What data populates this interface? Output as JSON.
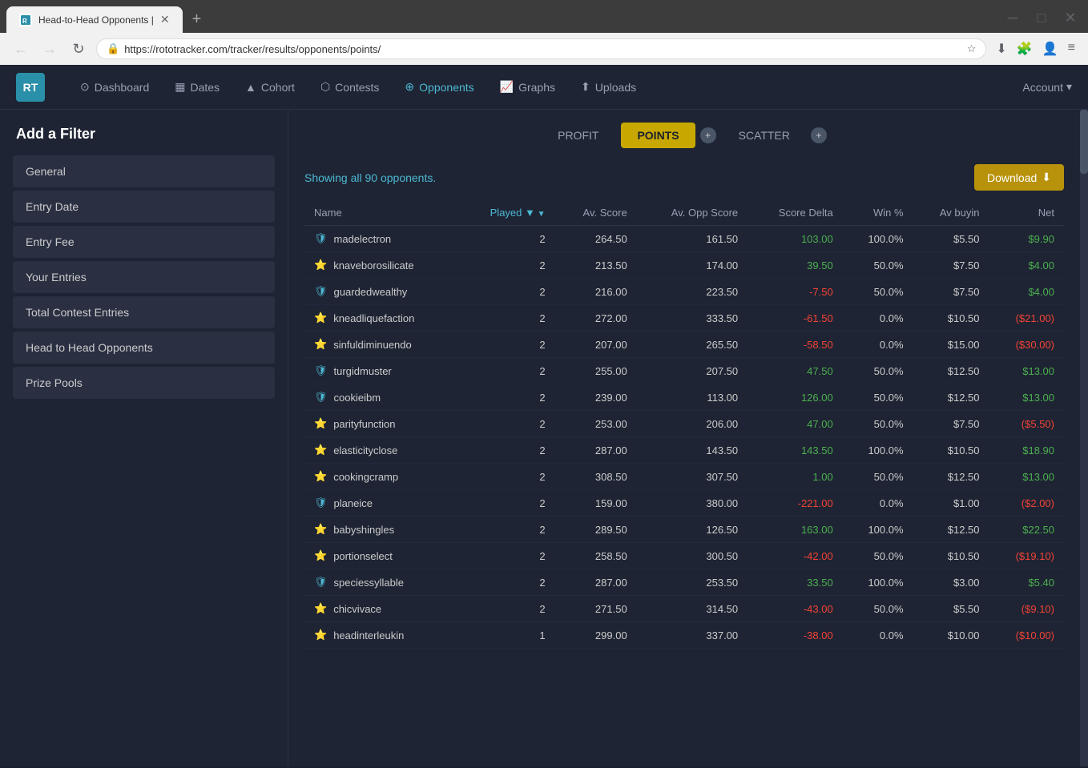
{
  "browser": {
    "tab_title": "Head-to-Head Opponents |",
    "url": "https://rototracker.com/tracker/results/opponents/points/",
    "new_tab_label": "+"
  },
  "nav": {
    "logo_text": "RT",
    "items": [
      {
        "label": "Dashboard",
        "icon": "⊙",
        "active": false
      },
      {
        "label": "Dates",
        "icon": "▦",
        "active": false
      },
      {
        "label": "Cohort",
        "icon": "▲",
        "active": false
      },
      {
        "label": "Contests",
        "icon": "⬡",
        "active": false
      },
      {
        "label": "Opponents",
        "icon": "⊕",
        "active": true
      },
      {
        "label": "Graphs",
        "icon": "📈",
        "active": false
      },
      {
        "label": "Uploads",
        "icon": "⬆",
        "active": false
      }
    ],
    "account_label": "Account"
  },
  "sidebar": {
    "title": "Add a Filter",
    "items": [
      {
        "label": "General"
      },
      {
        "label": "Entry Date"
      },
      {
        "label": "Entry Fee"
      },
      {
        "label": "Your Entries"
      },
      {
        "label": "Total Contest Entries"
      },
      {
        "label": "Head to Head Opponents"
      },
      {
        "label": "Prize Pools"
      }
    ]
  },
  "subtabs": [
    {
      "label": "PROFIT",
      "active": false
    },
    {
      "label": "POINTS",
      "active": true,
      "has_add": true
    },
    {
      "label": "SCATTER",
      "active": false,
      "has_add": true
    }
  ],
  "table": {
    "showing_text": "Showing all ",
    "showing_count": "90",
    "showing_suffix": " opponents.",
    "download_label": "Download",
    "columns": [
      "Name",
      "Played",
      "Av. Score",
      "Av. Opp Score",
      "Score Delta",
      "Win %",
      "Av buyin",
      "Net"
    ],
    "sorted_col": "Played",
    "rows": [
      {
        "name": "madelectron",
        "icon": "shield",
        "played": 2,
        "av_score": "264.50",
        "av_opp": "161.50",
        "delta": "103.00",
        "delta_type": "positive",
        "win": "100.0%",
        "buyin": "$5.50",
        "net": "$9.90",
        "net_type": "positive"
      },
      {
        "name": "knaveborosilicate",
        "icon": "star",
        "played": 2,
        "av_score": "213.50",
        "av_opp": "174.00",
        "delta": "39.50",
        "delta_type": "positive",
        "win": "50.0%",
        "buyin": "$7.50",
        "net": "$4.00",
        "net_type": "positive"
      },
      {
        "name": "guardedwealthy",
        "icon": "shield",
        "played": 2,
        "av_score": "216.00",
        "av_opp": "223.50",
        "delta": "-7.50",
        "delta_type": "negative",
        "win": "50.0%",
        "buyin": "$7.50",
        "net": "$4.00",
        "net_type": "positive"
      },
      {
        "name": "kneadliquefaction",
        "icon": "star",
        "played": 2,
        "av_score": "272.00",
        "av_opp": "333.50",
        "delta": "-61.50",
        "delta_type": "negative",
        "win": "0.0%",
        "buyin": "$10.50",
        "net": "($21.00)",
        "net_type": "negative"
      },
      {
        "name": "sinfuldiminuendo",
        "icon": "star",
        "played": 2,
        "av_score": "207.00",
        "av_opp": "265.50",
        "delta": "-58.50",
        "delta_type": "negative",
        "win": "0.0%",
        "buyin": "$15.00",
        "net": "($30.00)",
        "net_type": "negative"
      },
      {
        "name": "turgidmuster",
        "icon": "shield",
        "played": 2,
        "av_score": "255.00",
        "av_opp": "207.50",
        "delta": "47.50",
        "delta_type": "positive",
        "win": "50.0%",
        "buyin": "$12.50",
        "net": "$13.00",
        "net_type": "positive"
      },
      {
        "name": "cookieibm",
        "icon": "shield",
        "played": 2,
        "av_score": "239.00",
        "av_opp": "113.00",
        "delta": "126.00",
        "delta_type": "positive",
        "win": "50.0%",
        "buyin": "$12.50",
        "net": "$13.00",
        "net_type": "positive"
      },
      {
        "name": "parityfunction",
        "icon": "star",
        "played": 2,
        "av_score": "253.00",
        "av_opp": "206.00",
        "delta": "47.00",
        "delta_type": "positive",
        "win": "50.0%",
        "buyin": "$7.50",
        "net": "($5.50)",
        "net_type": "negative"
      },
      {
        "name": "elasticityclose",
        "icon": "star",
        "played": 2,
        "av_score": "287.00",
        "av_opp": "143.50",
        "delta": "143.50",
        "delta_type": "positive",
        "win": "100.0%",
        "buyin": "$10.50",
        "net": "$18.90",
        "net_type": "positive"
      },
      {
        "name": "cookingcramp",
        "icon": "star",
        "played": 2,
        "av_score": "308.50",
        "av_opp": "307.50",
        "delta": "1.00",
        "delta_type": "positive",
        "win": "50.0%",
        "buyin": "$12.50",
        "net": "$13.00",
        "net_type": "positive"
      },
      {
        "name": "planeice",
        "icon": "shield",
        "played": 2,
        "av_score": "159.00",
        "av_opp": "380.00",
        "delta": "-221.00",
        "delta_type": "negative",
        "win": "0.0%",
        "buyin": "$1.00",
        "net": "($2.00)",
        "net_type": "negative"
      },
      {
        "name": "babyshingles",
        "icon": "star",
        "played": 2,
        "av_score": "289.50",
        "av_opp": "126.50",
        "delta": "163.00",
        "delta_type": "positive",
        "win": "100.0%",
        "buyin": "$12.50",
        "net": "$22.50",
        "net_type": "positive"
      },
      {
        "name": "portionselect",
        "icon": "star",
        "played": 2,
        "av_score": "258.50",
        "av_opp": "300.50",
        "delta": "-42.00",
        "delta_type": "negative",
        "win": "50.0%",
        "buyin": "$10.50",
        "net": "($19.10)",
        "net_type": "negative"
      },
      {
        "name": "speciessyllable",
        "icon": "shield",
        "played": 2,
        "av_score": "287.00",
        "av_opp": "253.50",
        "delta": "33.50",
        "delta_type": "positive",
        "win": "100.0%",
        "buyin": "$3.00",
        "net": "$5.40",
        "net_type": "positive"
      },
      {
        "name": "chicvivace",
        "icon": "star",
        "played": 2,
        "av_score": "271.50",
        "av_opp": "314.50",
        "delta": "-43.00",
        "delta_type": "negative",
        "win": "50.0%",
        "buyin": "$5.50",
        "net": "($9.10)",
        "net_type": "negative"
      },
      {
        "name": "headinterleukin",
        "icon": "star",
        "played": 1,
        "av_score": "299.00",
        "av_opp": "337.00",
        "delta": "-38.00",
        "delta_type": "negative",
        "win": "0.0%",
        "buyin": "$10.00",
        "net": "($10.00)",
        "net_type": "negative"
      }
    ]
  },
  "icons": {
    "shield": "🛡",
    "star": "⭐",
    "download": "⬇",
    "sort_desc": "▼",
    "chevron_down": "▾",
    "lock": "🔒",
    "refresh": "↻",
    "back": "←",
    "forward": "→",
    "menu": "≡",
    "bookmark": "☆",
    "extensions": "🧩",
    "profile": "👤"
  }
}
